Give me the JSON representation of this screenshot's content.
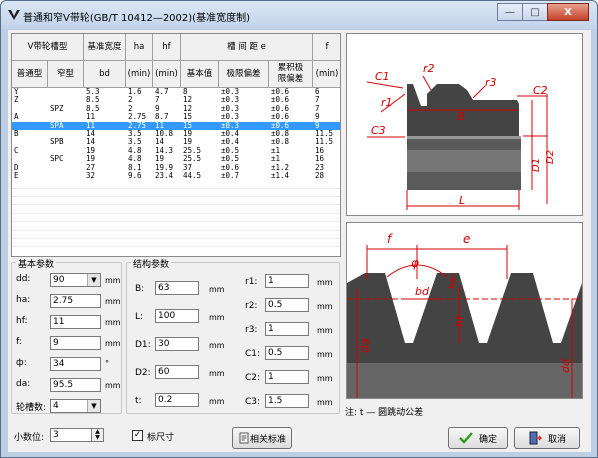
{
  "window": {
    "title": "普通和窄V带轮(GB/T 10412—2002)(基准宽度制)",
    "min_glyph": "—",
    "max_glyph": "□",
    "close_glyph": "X"
  },
  "table": {
    "header": {
      "belt_type": "V带轮槽型",
      "std_type": "普通型",
      "narrow_type": "窄型",
      "ref_width": "基准宽度",
      "bd": "bd",
      "ha": "ha",
      "ha_min": "(min)",
      "hf": "hf",
      "hf_min": "(min)",
      "groove_spacing": "槽 间 距 e",
      "basic": "基本值",
      "limit": "极限偏差",
      "cumulative": "累积极限偏差",
      "f": "f",
      "f_min": "(min)"
    },
    "rows": [
      [
        "Y",
        "",
        "5.3",
        "1.6",
        "4.7",
        "8",
        "±0.3",
        "±0.6",
        "6"
      ],
      [
        "Z",
        "",
        "8.5",
        "2",
        "7",
        "12",
        "±0.3",
        "±0.6",
        "7"
      ],
      [
        "",
        "SPZ",
        "8.5",
        "2",
        "9",
        "12",
        "±0.3",
        "±0.6",
        "7"
      ],
      [
        "A",
        "",
        "11",
        "2.75",
        "8.7",
        "15",
        "±0.3",
        "±0.6",
        "9"
      ],
      [
        "",
        "SPA",
        "11",
        "2.75",
        "11",
        "15",
        "±0.3",
        "±0.6",
        "9"
      ],
      [
        "B",
        "",
        "14",
        "3.5",
        "10.8",
        "19",
        "±0.4",
        "±0.8",
        "11.5"
      ],
      [
        "",
        "SPB",
        "14",
        "3.5",
        "14",
        "19",
        "±0.4",
        "±0.8",
        "11.5"
      ],
      [
        "C",
        "",
        "19",
        "4.8",
        "14.3",
        "25.5",
        "±0.5",
        "±1",
        "16"
      ],
      [
        "",
        "SPC",
        "19",
        "4.8",
        "19",
        "25.5",
        "±0.5",
        "±1",
        "16"
      ],
      [
        "D",
        "",
        "27",
        "8.1",
        "19.9",
        "37",
        "±0.6",
        "±1.2",
        "23"
      ],
      [
        "E",
        "",
        "32",
        "9.6",
        "23.4",
        "44.5",
        "±0.7",
        "±1.4",
        "28"
      ]
    ],
    "selected_row": 4
  },
  "basic_params": {
    "title": "基本参数",
    "dd": {
      "label": "dd:",
      "value": "90",
      "unit": "mm"
    },
    "ha": {
      "label": "ha:",
      "value": "2.75",
      "unit": "mm"
    },
    "hf": {
      "label": "hf:",
      "value": "11",
      "unit": "mm"
    },
    "f": {
      "label": "f:",
      "value": "9",
      "unit": "mm"
    },
    "phi": {
      "label": "ф:",
      "value": "34",
      "unit": "°"
    },
    "da": {
      "label": "da:",
      "value": "95.5",
      "unit": "mm"
    },
    "grooves": {
      "label": "轮槽数:",
      "value": "4"
    }
  },
  "struct_params": {
    "title": "结构参数",
    "B": {
      "label": "B:",
      "value": "63",
      "unit": "mm"
    },
    "L": {
      "label": "L:",
      "value": "100",
      "unit": "mm"
    },
    "D1": {
      "label": "D1:",
      "value": "30",
      "unit": "mm"
    },
    "D2": {
      "label": "D2:",
      "value": "60",
      "unit": "mm"
    },
    "t": {
      "label": "t:",
      "value": "0.2",
      "unit": "mm"
    },
    "r1": {
      "label": "r1:",
      "value": "1",
      "unit": "mm"
    },
    "r2": {
      "label": "r2:",
      "value": "0.5",
      "unit": "mm"
    },
    "r3": {
      "label": "r3:",
      "value": "1",
      "unit": "mm"
    },
    "C1": {
      "label": "C1:",
      "value": "0.5",
      "unit": "mm"
    },
    "C2": {
      "label": "C2:",
      "value": "1",
      "unit": "mm"
    },
    "C3": {
      "label": "C3:",
      "value": "1.5",
      "unit": "mm"
    }
  },
  "bottom": {
    "decimals_label": "小数位:",
    "decimals_value": "3",
    "show_dims_label": "标尺寸",
    "show_dims_checked": "✓",
    "related_std": "相关标准",
    "ok": "确定",
    "cancel": "取消",
    "note": "注: t — 圆跳动公差"
  },
  "diagram1": {
    "C1": "C1",
    "r2": "r2",
    "r1": "r1",
    "r3": "r3",
    "C2": "C2",
    "B": "B",
    "C3": "C3",
    "D1": "D1",
    "D2": "D2",
    "L": "L"
  },
  "diagram2": {
    "f": "f",
    "e": "e",
    "phi": "φ",
    "bd": "bd",
    "ha": "ha",
    "ht": "ht",
    "da": "da",
    "dd": "dd"
  },
  "colors": {
    "selected": "#3399ff",
    "dim": "#d60000",
    "part": "#555555"
  }
}
